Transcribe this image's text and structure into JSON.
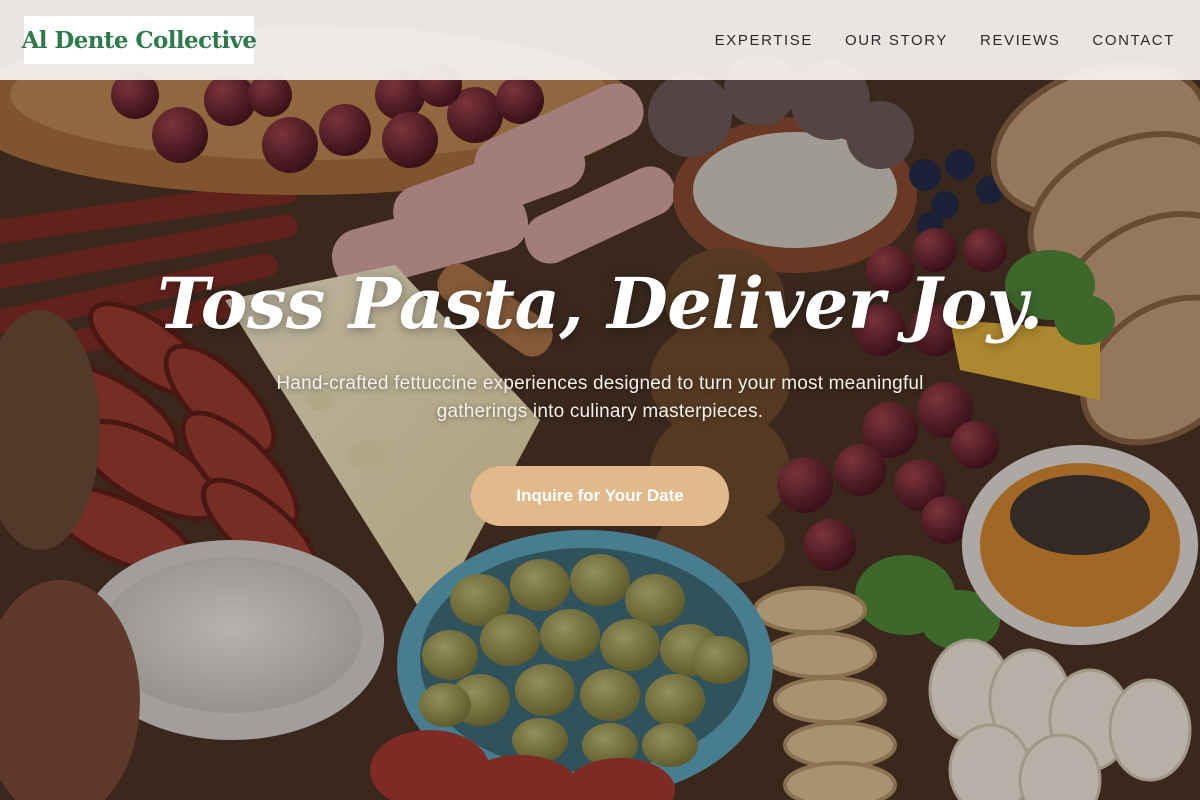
{
  "brand": {
    "name": "Al Dente Collective"
  },
  "nav": {
    "items": [
      {
        "label": "EXPERTISE"
      },
      {
        "label": "OUR STORY"
      },
      {
        "label": "REVIEWS"
      },
      {
        "label": "CONTACT"
      }
    ]
  },
  "hero": {
    "headline": "Toss Pasta, Deliver Joy.",
    "subtitle": "Hand-crafted fettuccine experiences designed to turn your most meaningful gatherings into culinary masterpieces.",
    "cta_label": "Inquire for Your Date",
    "background": "charcuterie-board-photo"
  },
  "colors": {
    "brand_green": "#2f7a4a",
    "cta_background": "#e2b98b",
    "nav_background": "#f6f4f2"
  }
}
